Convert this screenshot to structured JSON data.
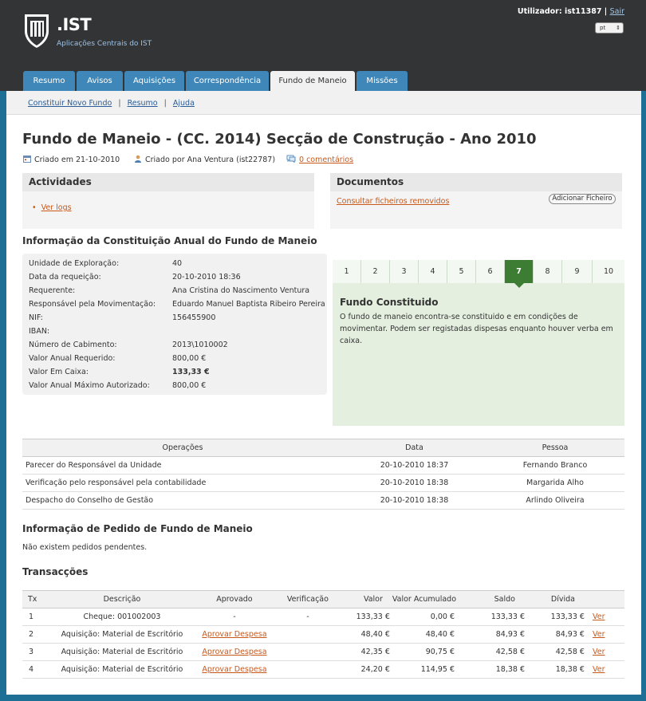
{
  "header": {
    "brand": ".IST",
    "subtitle": "Aplicações Centrais do IST",
    "user_label": "Utilizador: ist11387",
    "separator": "|",
    "logout": "Sair",
    "language": "pt"
  },
  "tabs": [
    "Resumo",
    "Avisos",
    "Aquisições",
    "Correspondência",
    "Fundo de Maneio",
    "Missões"
  ],
  "subnav": {
    "items": [
      "Constituir Novo Fundo",
      "Resumo",
      "Ajuda"
    ],
    "separator": "|"
  },
  "page": {
    "title": "Fundo de Maneio - (CC. 2014) Secção de Construção - Ano 2010",
    "created_on": "Criado em 21-10-2010",
    "created_by": "Criado por Ana Ventura (ist22787)",
    "comments": "0 comentários"
  },
  "activities": {
    "title": "Actividades",
    "link": "Ver logs"
  },
  "documents": {
    "title": "Documentos",
    "link": "Consultar ficheiros removidos",
    "button": "Adicionar Ficheiro"
  },
  "constitution": {
    "title": "Informação da Constituição Anual do Fundo de Maneio",
    "fields": [
      {
        "label": "Unidade de Exploração:",
        "value": "40"
      },
      {
        "label": "Data da requeição:",
        "value": "20-10-2010 18:36"
      },
      {
        "label": "Requerente:",
        "value": "Ana Cristina do Nascimento Ventura"
      },
      {
        "label": "Responsável pela Movimentação:",
        "value": "Eduardo Manuel Baptista Ribeiro Pereira"
      },
      {
        "label": "NIF:",
        "value": "156455900"
      },
      {
        "label": "IBAN:",
        "value": ""
      },
      {
        "label": "Número de Cabimento:",
        "value": "2013\\1010002"
      },
      {
        "label": "Valor Anual Requerido:",
        "value": "800,00 €"
      },
      {
        "label": "Valor Em Caixa:",
        "value": "133,33 €"
      },
      {
        "label": "Valor Anual Máximo Autorizado:",
        "value": "800,00 €"
      }
    ]
  },
  "progress": {
    "steps": [
      "1",
      "2",
      "3",
      "4",
      "5",
      "6",
      "7",
      "8",
      "9",
      "10"
    ],
    "active": "7",
    "title": "Fundo Constituido",
    "description": "O fundo de maneio encontra-se constituido e em condições de movimentar. Podem ser registadas dispesas enquanto houver verba em caixa."
  },
  "operations": {
    "headers": [
      "Operações",
      "Data",
      "Pessoa"
    ],
    "rows": [
      [
        "Parecer do Responsável da Unidade",
        "20-10-2010 18:37",
        "Fernando Branco"
      ],
      [
        "Verificação pelo responsável pela contabilidade",
        "20-10-2010 18:38",
        "Margarida Alho"
      ],
      [
        "Despacho do Conselho de Gestão",
        "20-10-2010 18:38",
        "Arlindo Oliveira"
      ]
    ]
  },
  "requests": {
    "title": "Informação de Pedido de Fundo de Maneio",
    "empty": "Não existem pedidos pendentes."
  },
  "transactions": {
    "title": "Transacções",
    "headers": [
      "Tx",
      "Descrição",
      "Aprovado",
      "Verificação",
      "Valor",
      "Valor Acumulado",
      "Saldo",
      "Dívida"
    ],
    "view_label": "Ver",
    "rows": [
      [
        "1",
        "Cheque: 001002003",
        "-",
        "-",
        "133,33 €",
        "0,00 €",
        "133,33 €",
        "133,33 €"
      ],
      [
        "2",
        "Aquisição: Material de Escritório",
        "Aprovar Despesa",
        "",
        "48,40 €",
        "48,40 €",
        "84,93 €",
        "84,93 €"
      ],
      [
        "3",
        "Aquisição: Material de Escritório",
        "Aprovar Despesa",
        "",
        "42,35 €",
        "90,75 €",
        "42,58 €",
        "42,58 €"
      ],
      [
        "4",
        "Aquisição: Material de Escritório",
        "Aprovar Despesa",
        "",
        "24,20 €",
        "114,95 €",
        "18,38 €",
        "18,38 €"
      ]
    ]
  }
}
